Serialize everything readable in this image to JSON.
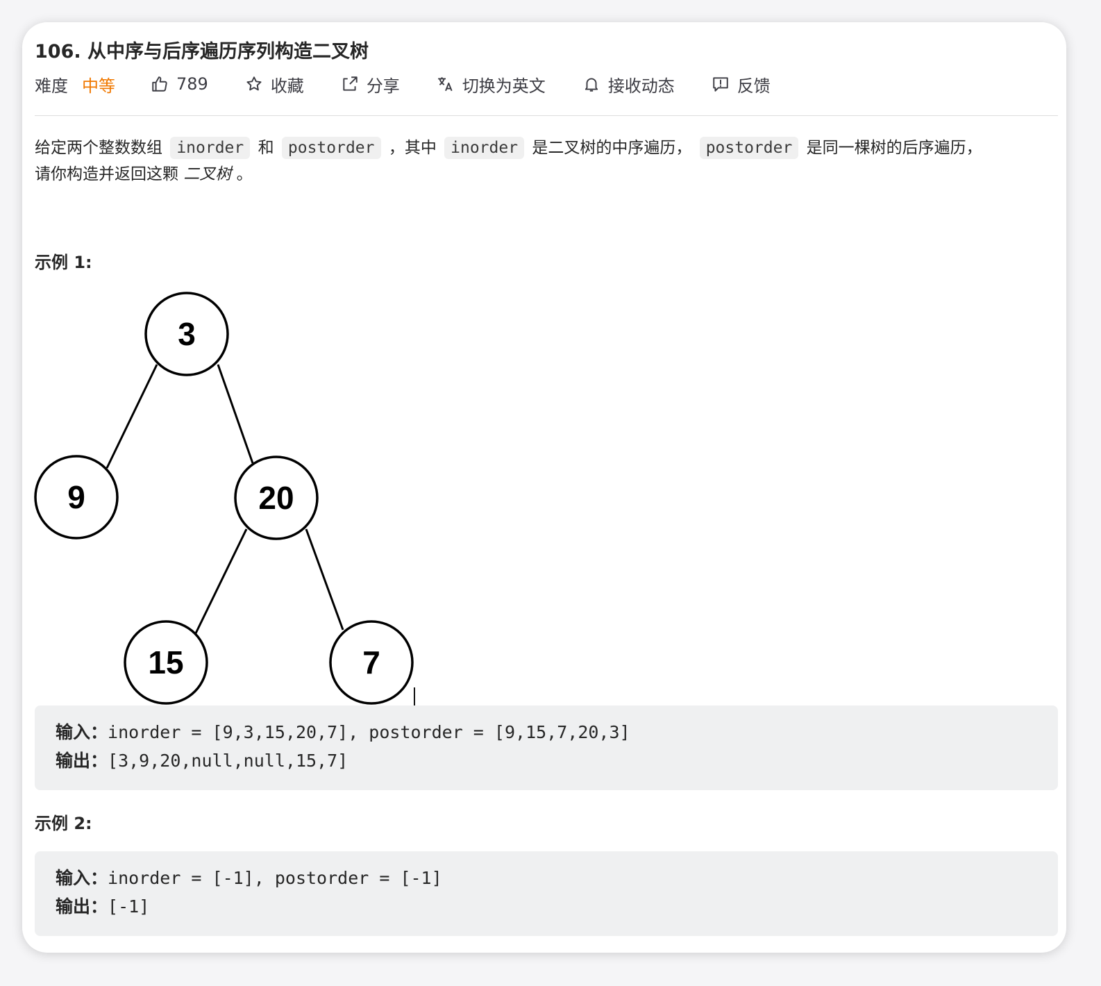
{
  "problem": {
    "title": "106. 从中序与后序遍历序列构造二叉树"
  },
  "meta": {
    "difficulty_label": "难度",
    "difficulty_value": "中等",
    "difficulty_color": "#f07800",
    "likes": "789",
    "favorite": "收藏",
    "share": "分享",
    "switch_lang": "切换为英文",
    "subscribe": "接收动态",
    "feedback": "反馈",
    "icons": [
      "thumbs-up-icon",
      "star-icon",
      "share-icon",
      "translate-icon",
      "bell-icon",
      "feedback-icon"
    ]
  },
  "description": {
    "p1": "给定两个整数数组",
    "code_inorder": "inorder",
    "p2": "和",
    "code_postorder": "postorder",
    "p3": "，其中",
    "p4": "是二叉树的中序遍历，",
    "p5": "是同一棵树的后序遍历，",
    "p6": "请你构造并返回这颗",
    "p7_em": "二叉树",
    "p8": "。"
  },
  "example1": {
    "heading": "示例 1:",
    "tree_nodes": [
      "3",
      "9",
      "20",
      "15",
      "7"
    ],
    "input_label": "输入：",
    "input_value": "inorder = [9,3,15,20,7], postorder = [9,15,7,20,3]",
    "output_label": "输出：",
    "output_value": "[3,9,20,null,null,15,7]"
  },
  "example2": {
    "heading": "示例 2:",
    "input_label": "输入：",
    "input_value": "inorder = [-1], postorder = [-1]",
    "output_label": "输出：",
    "output_value": "[-1]"
  }
}
